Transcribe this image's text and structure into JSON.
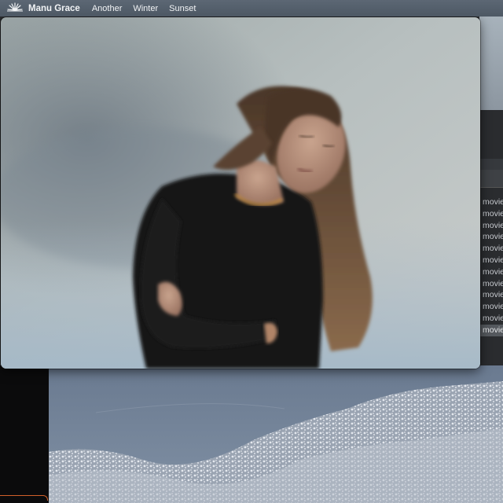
{
  "menubar": {
    "logo_icon": "sunburst-logo-icon",
    "app_name": "Manu Grace",
    "menus": [
      "Another",
      "Winter",
      "Sunset"
    ]
  },
  "finder": {
    "items": [
      "movie",
      "movie",
      "movie",
      "movie",
      "movie",
      "movie",
      "movie",
      "movie",
      "movie",
      "movie",
      "movie",
      "movie"
    ],
    "selected_index": 11
  },
  "photo": {
    "subject": "woman-in-black-sweater-portrait"
  },
  "wallpaper": {
    "subject": "snowy-mountain-landscape"
  },
  "colors": {
    "menubar": "#55606c",
    "accent_orange": "#d0602a"
  }
}
